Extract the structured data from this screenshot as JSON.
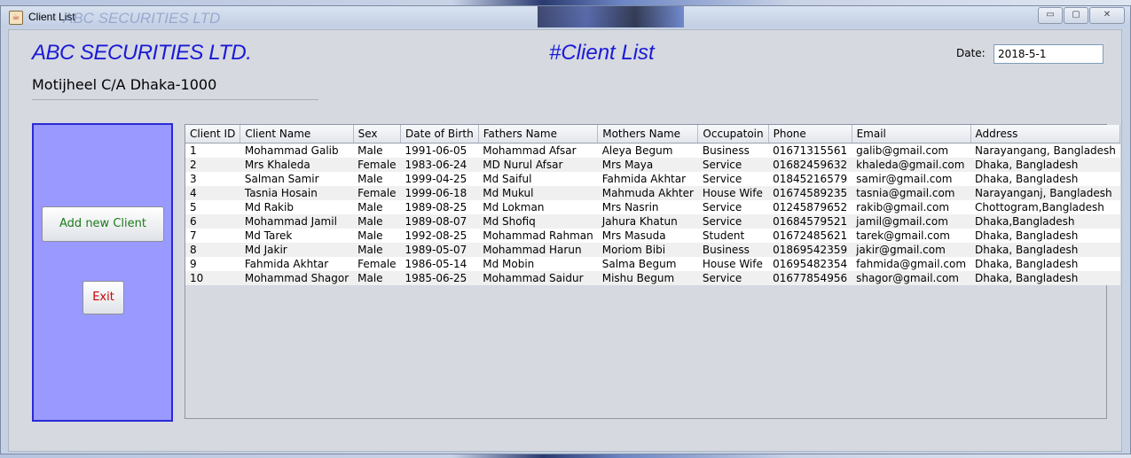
{
  "window": {
    "title": "Client List",
    "background_title_ghost": "ABC SECURITIES LTD",
    "controls": {
      "minimize": "▭",
      "maximize": "▢",
      "close": "✕"
    }
  },
  "header": {
    "company": "ABC SECURITIES LTD.",
    "address": "Motijheel C/A Dhaka-1000",
    "page_title": "#Client List",
    "date_label": "Date:",
    "date_value": "2018-5-1"
  },
  "sidebar": {
    "add_label": "Add new Client",
    "exit_label": "Exit"
  },
  "table": {
    "columns": [
      "Client ID",
      "Client Name",
      "Sex",
      "Date of Birth",
      "Fathers Name",
      "Mothers Name",
      "Occupatoin",
      "Phone",
      "Email",
      "Address"
    ],
    "rows": [
      [
        "1",
        "Mohammad Galib",
        "Male",
        "1991-06-05",
        "Mohammad Afsar",
        "Aleya Begum",
        "Business",
        "01671315561",
        "galib@gmail.com",
        "Narayangang, Bangladesh"
      ],
      [
        "2",
        "Mrs Khaleda",
        "Female",
        "1983-06-24",
        "MD Nurul Afsar",
        "Mrs Maya",
        "Service",
        "01682459632",
        "khaleda@gmail.com",
        "Dhaka, Bangladesh"
      ],
      [
        "3",
        "Salman Samir",
        "Male",
        "1999-04-25",
        "Md Saiful",
        "Fahmida Akhtar",
        "Service",
        "01845216579",
        "samir@gmail.com",
        "Dhaka, Bangladesh"
      ],
      [
        "4",
        "Tasnia Hosain",
        "Female",
        "1999-06-18",
        "Md Mukul",
        "Mahmuda Akhter",
        "House Wife",
        "01674589235",
        "tasnia@gmail.com",
        "Narayanganj, Bangladesh"
      ],
      [
        "5",
        "Md Rakib",
        "Male",
        "1989-08-25",
        "Md Lokman",
        "Mrs Nasrin",
        "Service",
        "01245879652",
        "rakib@gmail.com",
        "Chottogram,Bangladesh"
      ],
      [
        "6",
        "Mohammad Jamil",
        "Male",
        "1989-08-07",
        "Md Shofiq",
        "Jahura Khatun",
        "Service",
        "01684579521",
        "jamil@gmail.com",
        "Dhaka,Bangladesh"
      ],
      [
        "7",
        "Md Tarek",
        "Male",
        "1992-08-25",
        "Mohammad Rahman",
        "Mrs Masuda",
        "Student",
        "01672485621",
        "tarek@gmail.com",
        "Dhaka, Bangladesh"
      ],
      [
        "8",
        "Md Jakir",
        "Male",
        "1989-05-07",
        "Mohammad Harun",
        "Moriom Bibi",
        "Business",
        "01869542359",
        "jakir@gmail.com",
        "Dhaka, Bangladesh"
      ],
      [
        "9",
        "Fahmida Akhtar",
        "Female",
        "1986-05-14",
        "Md Mobin",
        "Salma Begum",
        "House Wife",
        "01695482354",
        "fahmida@gmail.com",
        "Dhaka, Bangladesh"
      ],
      [
        "10",
        "Mohammad Shagor",
        "Male",
        "1985-06-25",
        "Mohammad Saidur",
        "Mishu Begum",
        "Service",
        "01677854956",
        "shagor@gmail.com",
        "Dhaka, Bangladesh"
      ]
    ]
  },
  "colors": {
    "heading_blue": "#1a1ad6",
    "panel_fill": "#9999ff",
    "panel_border": "#2b2bd6",
    "add_text": "#1b7a1b",
    "exit_text": "#cc0000"
  }
}
